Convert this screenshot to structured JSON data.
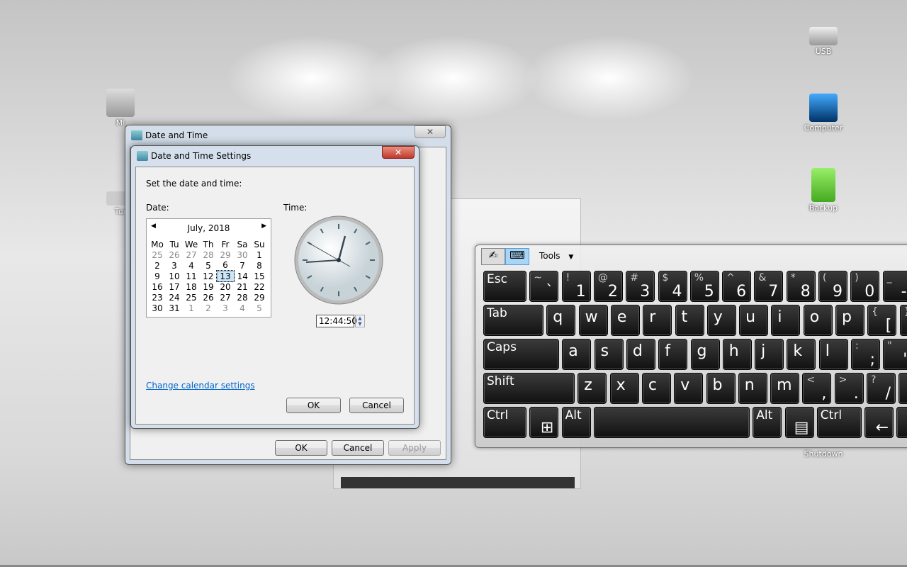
{
  "desktop": {
    "icons": [
      {
        "label": "USB",
        "icon": "usb-drive-icon"
      },
      {
        "label": "Computer",
        "icon": "computer-icon"
      },
      {
        "label": "Backup",
        "icon": "backup-icon"
      },
      {
        "label": "Shutdown",
        "icon": "shutdown-icon"
      },
      {
        "label": "Mi",
        "icon": "machine-shortcut-icon"
      },
      {
        "label": "Tur",
        "icon": "shortcut-icon"
      }
    ]
  },
  "outer_window": {
    "title": "Date and Time",
    "ok": "OK",
    "cancel": "Cancel",
    "apply": "Apply"
  },
  "dialog": {
    "title": "Date and Time Settings",
    "prompt": "Set the date and time:",
    "date_label": "Date:",
    "time_label": "Time:",
    "calendar": {
      "month": "July, 2018",
      "weekdays": [
        "Mo",
        "Tu",
        "We",
        "Th",
        "Fr",
        "Sa",
        "Su"
      ],
      "weeks": [
        [
          "25",
          "26",
          "27",
          "28",
          "29",
          "30",
          "1"
        ],
        [
          "2",
          "3",
          "4",
          "5",
          "6",
          "7",
          "8"
        ],
        [
          "9",
          "10",
          "11",
          "12",
          "13",
          "14",
          "15"
        ],
        [
          "16",
          "17",
          "18",
          "19",
          "20",
          "21",
          "22"
        ],
        [
          "23",
          "24",
          "25",
          "26",
          "27",
          "28",
          "29"
        ],
        [
          "30",
          "31",
          "1",
          "2",
          "3",
          "4",
          "5"
        ]
      ],
      "selected": "13"
    },
    "time": "12:44:50",
    "change_calendar_link": "Change calendar settings",
    "ok": "OK",
    "cancel": "Cancel"
  },
  "keyboard": {
    "tools_label": "Tools",
    "rows": [
      [
        {
          "m": "Esc"
        },
        {
          "m": "`",
          "s": "~"
        },
        {
          "m": "1",
          "s": "!"
        },
        {
          "m": "2",
          "s": "@"
        },
        {
          "m": "3",
          "s": "#"
        },
        {
          "m": "4",
          "s": "$"
        },
        {
          "m": "5",
          "s": "%"
        },
        {
          "m": "6",
          "s": "^"
        },
        {
          "m": "7",
          "s": "&"
        },
        {
          "m": "8",
          "s": "*"
        },
        {
          "m": "9",
          "s": "("
        },
        {
          "m": "0",
          "s": ")"
        },
        {
          "m": "-",
          "s": "_"
        }
      ],
      [
        {
          "m": "Tab"
        },
        {
          "m": "q"
        },
        {
          "m": "w"
        },
        {
          "m": "e"
        },
        {
          "m": "r"
        },
        {
          "m": "t"
        },
        {
          "m": "y"
        },
        {
          "m": "u"
        },
        {
          "m": "i"
        },
        {
          "m": "o"
        },
        {
          "m": "p"
        },
        {
          "m": "[",
          "s": "{"
        },
        {
          "m": "]",
          "s": "}"
        }
      ],
      [
        {
          "m": "Caps"
        },
        {
          "m": "a"
        },
        {
          "m": "s"
        },
        {
          "m": "d"
        },
        {
          "m": "f"
        },
        {
          "m": "g"
        },
        {
          "m": "h"
        },
        {
          "m": "j"
        },
        {
          "m": "k"
        },
        {
          "m": "l"
        },
        {
          "m": ";",
          "s": ":"
        },
        {
          "m": "'",
          "s": "\""
        }
      ],
      [
        {
          "m": "Shift"
        },
        {
          "m": "z"
        },
        {
          "m": "x"
        },
        {
          "m": "c"
        },
        {
          "m": "v"
        },
        {
          "m": "b"
        },
        {
          "m": "n"
        },
        {
          "m": "m"
        },
        {
          "m": ",",
          "s": "<"
        },
        {
          "m": ".",
          "s": ">"
        },
        {
          "m": "/",
          "s": "?"
        },
        {
          "m": "↑"
        }
      ],
      [
        {
          "m": "Ctrl"
        },
        {
          "m": "⊞"
        },
        {
          "m": "Alt"
        },
        {
          "m": ""
        },
        {
          "m": "Alt"
        },
        {
          "m": "▤"
        },
        {
          "m": "Ctrl"
        },
        {
          "m": "←"
        },
        {
          "m": "↓"
        }
      ]
    ]
  }
}
